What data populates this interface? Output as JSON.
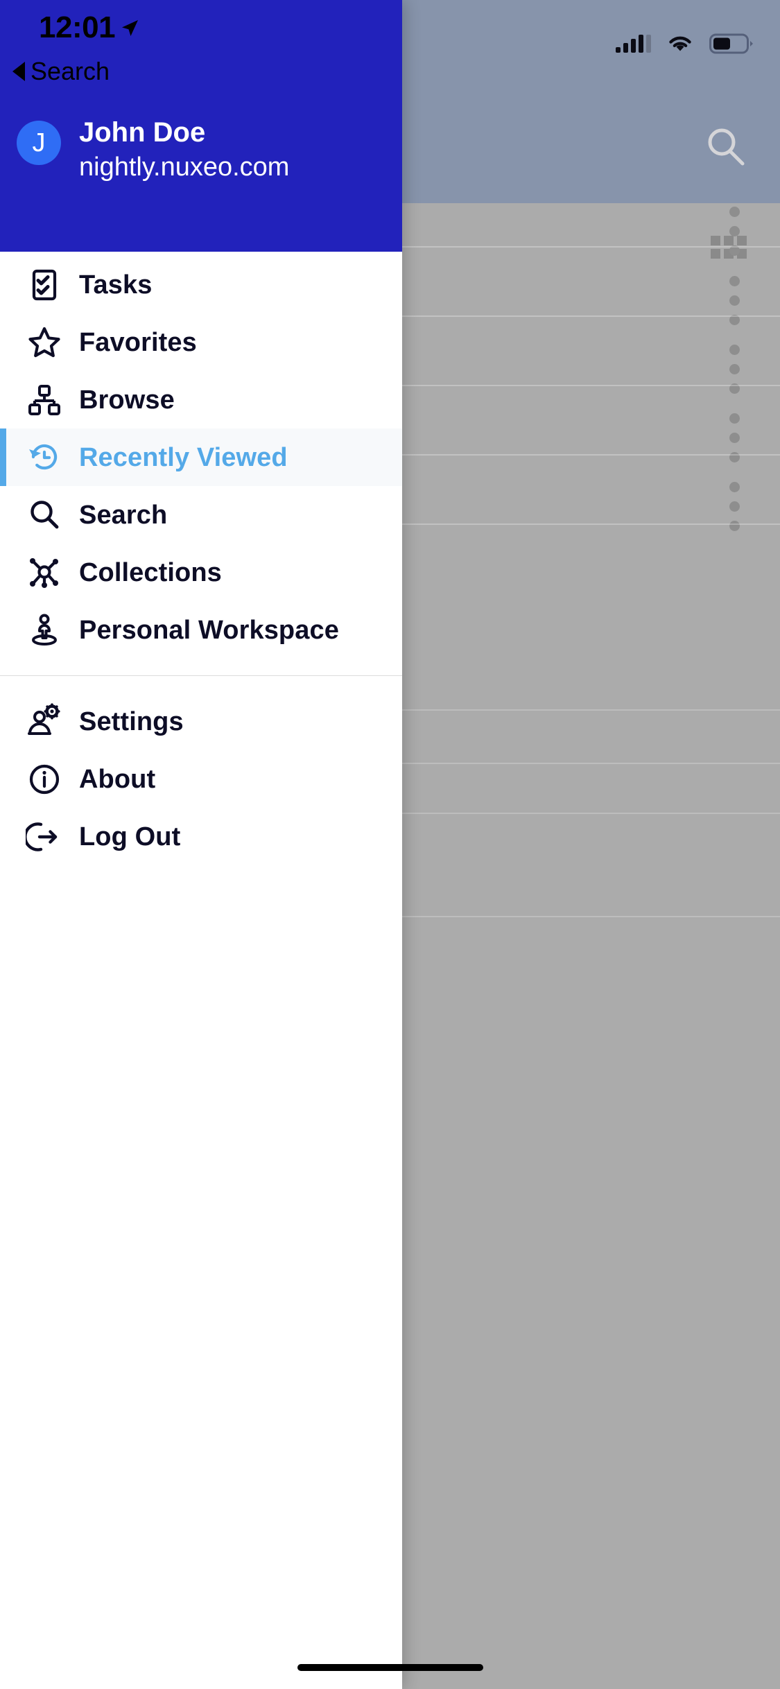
{
  "status_bar": {
    "time": "12:01",
    "location_icon": "location-arrow-icon",
    "signal_icon": "cellular-signal-icon",
    "wifi_icon": "wifi-icon",
    "battery_icon": "battery-icon"
  },
  "back": {
    "label": "Search",
    "icon": "back-caret-icon"
  },
  "account": {
    "avatar_initial": "J",
    "name": "John Doe",
    "server_url": "nightly.nuxeo.com"
  },
  "menu": {
    "primary": [
      {
        "id": "tasks",
        "label": "Tasks",
        "icon": "tasks-checklist-icon",
        "active": false
      },
      {
        "id": "favorites",
        "label": "Favorites",
        "icon": "star-icon",
        "active": false
      },
      {
        "id": "browse",
        "label": "Browse",
        "icon": "hierarchy-icon",
        "active": false
      },
      {
        "id": "recently-viewed",
        "label": "Recently Viewed",
        "icon": "history-clock-icon",
        "active": true
      },
      {
        "id": "search",
        "label": "Search",
        "icon": "search-icon",
        "active": false
      },
      {
        "id": "collections",
        "label": "Collections",
        "icon": "collections-hub-icon",
        "active": false
      },
      {
        "id": "personal-workspace",
        "label": "Personal Workspace",
        "icon": "person-platform-icon",
        "active": false
      }
    ],
    "secondary": [
      {
        "id": "settings",
        "label": "Settings",
        "icon": "person-gear-icon",
        "active": false
      },
      {
        "id": "about",
        "label": "About",
        "icon": "info-circle-icon",
        "active": false
      },
      {
        "id": "logout",
        "label": "Log Out",
        "icon": "logout-arrow-icon",
        "active": false
      }
    ]
  },
  "background_app": {
    "search_icon": "search-icon",
    "grid_view_icon": "grid-view-icon",
    "row_menu_icon": "more-vertical-icon",
    "row_count": 5
  },
  "colors": {
    "header_blue": "#2222bb",
    "avatar_blue": "#2f6df5",
    "accent_blue": "#54a9e8",
    "active_row_bg": "#f7f9fb",
    "icon_dark": "#0d0d26",
    "scrim_gray": "#ababab"
  }
}
